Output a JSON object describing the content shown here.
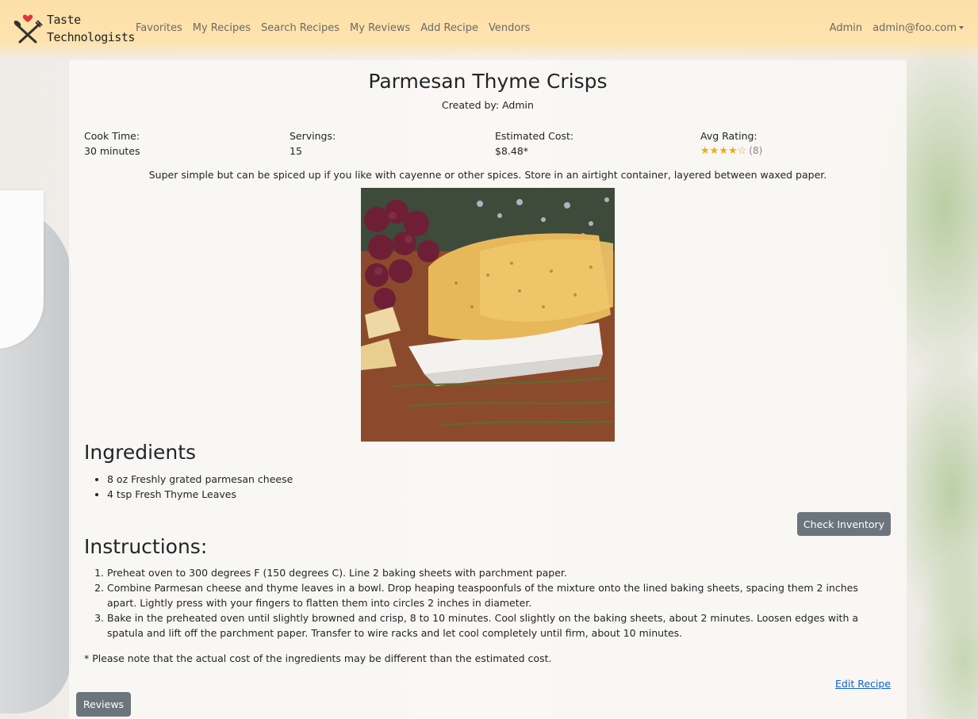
{
  "navbar": {
    "brand_line1": "Taste",
    "brand_line2": "Technologists",
    "links": [
      "Favorites",
      "My Recipes",
      "Search Recipes",
      "My Reviews",
      "Add Recipe",
      "Vendors"
    ],
    "right": {
      "admin": "Admin",
      "user_email": "admin@foo.com"
    }
  },
  "recipe": {
    "title": "Parmesan Thyme Crisps",
    "created_by": "Created by: Admin",
    "cook_time_label": "Cook Time:",
    "cook_time_value": "30 minutes",
    "servings_label": "Servings:",
    "servings_value": "15",
    "cost_label": "Estimated Cost:",
    "cost_value": "$8.48*",
    "rating_label": "Avg Rating:",
    "rating_stars": 4,
    "rating_max": 5,
    "rating_count": "(8)",
    "description": "Super simple but can be spiced up if you like with cayenne or other spices. Store in an airtight container, layered between waxed paper.",
    "ingredients_heading": "Ingredients",
    "ingredients": [
      "8 oz Freshly grated parmesan cheese",
      "4 tsp Fresh Thyme Leaves"
    ],
    "check_inventory_label": "Check Inventory",
    "instructions_heading": "Instructions:",
    "instructions": [
      "Preheat oven to 300 degrees F (150 degrees C). Line 2 baking sheets with parchment paper.",
      "Combine Parmesan cheese and thyme leaves in a bowl. Drop heaping teaspoonfuls of the mixture onto the lined baking sheets, spacing them 2 inches apart. Lightly press with your fingers to flatten them into circles 2 inches in diameter.",
      "Bake in the preheated oven until slightly browned and crisp, 8 to 10 minutes. Cool slightly on the baking sheets, about 2 minutes. Loosen edges with a spatula and lift off the parchment paper. Transfer to wire racks and let cool completely until firm, about 10 minutes."
    ],
    "cost_note": "* Please note that the actual cost of the ingredients may be different than the estimated cost.",
    "edit_label": "Edit Recipe",
    "reviews_label": "Reviews"
  },
  "colors": {
    "navbar_bg": "#fde0a8",
    "button_bg": "#6c757d",
    "link": "#0b63d1",
    "star": "#f0a81c"
  }
}
